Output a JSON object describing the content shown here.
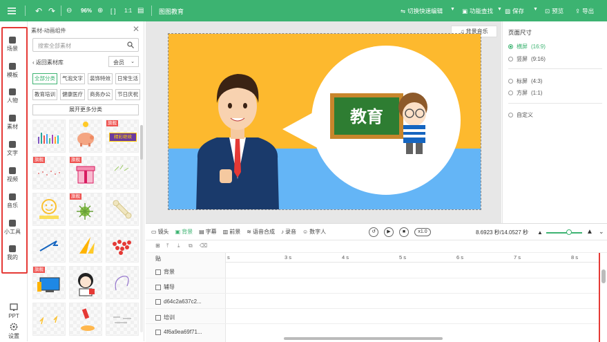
{
  "app": {
    "title": "图图教育",
    "zoom": "96%"
  },
  "topbar": {
    "menu_icon": "menu-icon",
    "quick_edit": "切换快速编辑",
    "feature_search": "功能查找",
    "save": "保存",
    "preview": "预览",
    "export": "导出"
  },
  "nav": {
    "items": [
      {
        "label": "场景",
        "icon": "scene-icon"
      },
      {
        "label": "模板",
        "icon": "template-icon"
      },
      {
        "label": "人物",
        "icon": "person-icon"
      },
      {
        "label": "素材",
        "icon": "material-icon"
      },
      {
        "label": "文字",
        "icon": "text-icon"
      },
      {
        "label": "视频",
        "icon": "video-icon"
      },
      {
        "label": "音乐",
        "icon": "music-icon"
      },
      {
        "label": "小工具",
        "icon": "toolbox-icon"
      },
      {
        "label": "我的",
        "icon": "mine-icon"
      }
    ],
    "ppt": "PPT",
    "settings": "设置"
  },
  "panel": {
    "title": "素材-动画组件",
    "search_placeholder": "搜索全部素材",
    "back": "返回素材库",
    "vip": "会员",
    "categories": [
      "全部分类",
      "气泡文字",
      "装饰特效",
      "日常生活",
      "教育培训",
      "健康医疗",
      "商务办公",
      "节日庆祝"
    ],
    "more": "展开更多分类",
    "badge": "旗舰",
    "thumb_caption": "精彩继续"
  },
  "stage": {
    "bg_music": "背景音乐",
    "board_text": "教育"
  },
  "page_size": {
    "title": "页面尺寸",
    "options": [
      {
        "label": "横屏",
        "ratio": "(16:9)"
      },
      {
        "label": "竖屏",
        "ratio": "(9:16)"
      },
      {
        "label": "标屏",
        "ratio": "(4:3)"
      },
      {
        "label": "方屏",
        "ratio": "(1:1)"
      },
      {
        "label": "自定义",
        "ratio": ""
      }
    ]
  },
  "timeline": {
    "tabs": [
      "镜头",
      "背景",
      "字幕",
      "前景",
      "语音合成",
      "录音",
      "数字人"
    ],
    "speed": "x1.0",
    "time": "8.6923 秒/14.0527 秒",
    "ticks": [
      "s",
      "3 s",
      "4 s",
      "5 s",
      "6 s",
      "7 s",
      "8 s"
    ],
    "tracks": [
      "背景",
      "辅导",
      "d64c2a637c2...",
      "培训",
      "4f6a9ea69f71..."
    ],
    "header_label": "贴"
  },
  "colors": {
    "accent": "#3cb371",
    "stage_yellow": "#fdb92e",
    "stage_blue": "#64b5f6"
  }
}
